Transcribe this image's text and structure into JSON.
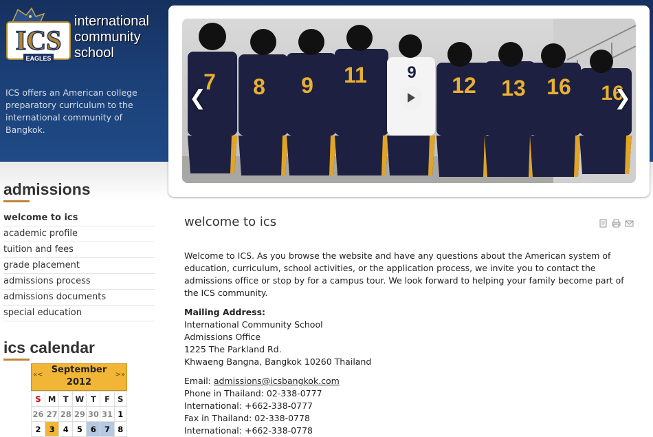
{
  "brand": {
    "logo_letters": "ICS",
    "logo_sub": "EAGLES",
    "name_line1": "international",
    "name_line2": "community",
    "name_line3": "school",
    "tagline": "ICS offers an American college preparatory curriculum to the international community of Bangkok."
  },
  "slider": {
    "prev_icon": "chevron-left-icon",
    "next_icon": "chevron-right-icon",
    "play_icon": "play-icon",
    "jersey_numbers": [
      "7",
      "8",
      "9",
      "11",
      "9",
      "12",
      "13",
      "16",
      "16"
    ]
  },
  "sidebar": {
    "heading": "admissions",
    "items": [
      {
        "label": "welcome to ics",
        "active": true
      },
      {
        "label": "academic profile"
      },
      {
        "label": "tuition and fees"
      },
      {
        "label": "grade placement"
      },
      {
        "label": "admissions process"
      },
      {
        "label": "admissions documents"
      },
      {
        "label": "special education"
      }
    ]
  },
  "calendar": {
    "heading": "ics calendar",
    "prev": "«<",
    "next": ">»",
    "month": "September",
    "year": "2012",
    "weekdays": [
      "S",
      "M",
      "T",
      "W",
      "T",
      "F",
      "S"
    ],
    "week1": [
      "26",
      "27",
      "28",
      "29",
      "30",
      "31",
      "1"
    ],
    "week2": [
      "2",
      "3",
      "4",
      "5",
      "6",
      "7",
      "8"
    ]
  },
  "content": {
    "title": "welcome to ics",
    "toolbar_icons": [
      "pdf-icon",
      "print-icon",
      "email-icon"
    ],
    "intro": "Welcome to ICS. As you browse the website and have any questions about the American system of education, curriculum, school activities, or the application process, we invite you to contact the admissions office or stop by for a campus tour. We look forward to helping your family become part of the ICS community.",
    "mailing_label": "Mailing Address:",
    "address": [
      "International Community School",
      "Admissions Office",
      "1225 The Parkland Rd.",
      "Khwaeng Bangna, Bangkok 10260 Thailand"
    ],
    "email_label": "Email: ",
    "email": "admissions@icsbangkok.com",
    "phones": [
      "Phone in Thailand: 02-338-0777",
      "International: +662-338-0777",
      "Fax in Thailand: 02-338-0778",
      "International: +662-338-0778"
    ]
  },
  "colors": {
    "header_blue": "#1b3f76",
    "accent_orange": "#c08437",
    "calendar_gold": "#f2b637",
    "event_blue": "#b5c9e2"
  }
}
